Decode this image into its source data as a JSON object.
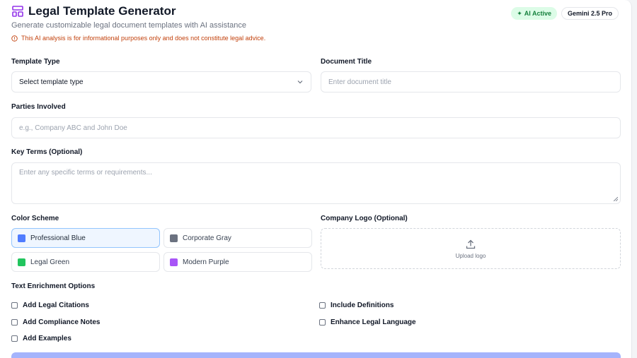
{
  "header": {
    "title": "Legal Template Generator",
    "subtitle": "Generate customizable legal document templates with AI assistance",
    "disclaimer": "This AI analysis is for informational purposes only and does not constitute legal advice.",
    "badge_ai": "AI Active",
    "badge_model": "Gemini 2.5 Pro"
  },
  "form": {
    "template_type_label": "Template Type",
    "template_type_value": "Select template type",
    "document_title_label": "Document Title",
    "document_title_placeholder": "Enter document title",
    "parties_label": "Parties Involved",
    "parties_placeholder": "e.g., Company ABC and John Doe",
    "key_terms_label": "Key Terms (Optional)",
    "key_terms_placeholder": "Enter any specific terms or requirements..."
  },
  "color_scheme": {
    "label": "Color Scheme",
    "options": [
      {
        "label": "Professional Blue",
        "color": "#4f7cff",
        "selected": true
      },
      {
        "label": "Corporate Gray",
        "color": "#6b7280",
        "selected": false
      },
      {
        "label": "Legal Green",
        "color": "#22c55e",
        "selected": false
      },
      {
        "label": "Modern Purple",
        "color": "#a855f7",
        "selected": false
      }
    ]
  },
  "logo": {
    "label": "Company Logo (Optional)",
    "upload_text": "Upload logo"
  },
  "enrichment": {
    "label": "Text Enrichment Options",
    "options": [
      "Add Legal Citations",
      "Include Definitions",
      "Add Compliance Notes",
      "Enhance Legal Language",
      "Add Examples"
    ]
  },
  "colors": {
    "accent": "#7c3aed",
    "warning": "#c2410c",
    "submit": "#a5b4fc"
  }
}
